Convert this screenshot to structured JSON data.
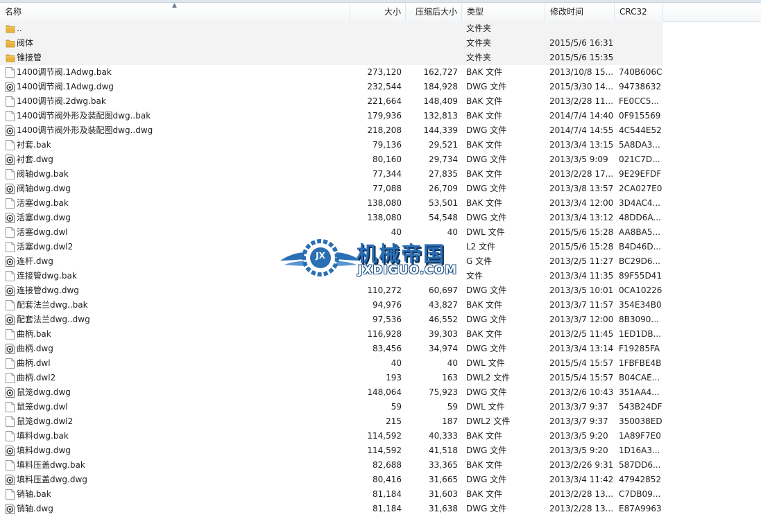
{
  "header": {
    "name": "名称",
    "size": "大小",
    "packed": "压缩后大小",
    "type": "类型",
    "modified": "修改时间",
    "crc": "CRC32"
  },
  "rows": [
    {
      "name": "..",
      "size": "",
      "packed": "",
      "type": "文件夹",
      "modified": "",
      "crc": "",
      "icon": "parent-folder"
    },
    {
      "name": "阀体",
      "size": "",
      "packed": "",
      "type": "文件夹",
      "modified": "2015/5/6 16:31",
      "crc": "",
      "icon": "folder"
    },
    {
      "name": "锥接管",
      "size": "",
      "packed": "",
      "type": "文件夹",
      "modified": "2015/5/6 15:35",
      "crc": "",
      "icon": "folder"
    },
    {
      "name": "1400调节阀.1Adwg.bak",
      "size": "273,120",
      "packed": "162,727",
      "type": "BAK 文件",
      "modified": "2013/10/8 15...",
      "crc": "740B606C",
      "icon": "file"
    },
    {
      "name": "1400调节阀.1Adwg.dwg",
      "size": "232,544",
      "packed": "184,928",
      "type": "DWG 文件",
      "modified": "2015/3/30 14...",
      "crc": "94738632",
      "icon": "dwg"
    },
    {
      "name": "1400调节阀.2dwg.bak",
      "size": "221,664",
      "packed": "148,409",
      "type": "BAK 文件",
      "modified": "2013/2/28 11...",
      "crc": "FE0CC5...",
      "icon": "file"
    },
    {
      "name": "1400调节阀外形及装配图dwg..bak",
      "size": "179,936",
      "packed": "132,813",
      "type": "BAK 文件",
      "modified": "2014/7/4 14:40",
      "crc": "0F915569",
      "icon": "file"
    },
    {
      "name": "1400调节阀外形及装配图dwg..dwg",
      "size": "218,208",
      "packed": "144,339",
      "type": "DWG 文件",
      "modified": "2014/7/4 14:55",
      "crc": "4C544E52",
      "icon": "dwg"
    },
    {
      "name": "衬套.bak",
      "size": "79,136",
      "packed": "29,521",
      "type": "BAK 文件",
      "modified": "2013/3/4 13:15",
      "crc": "5A8DA3...",
      "icon": "file"
    },
    {
      "name": "衬套.dwg",
      "size": "80,160",
      "packed": "29,734",
      "type": "DWG 文件",
      "modified": "2013/3/5 9:09",
      "crc": "021C7D...",
      "icon": "dwg"
    },
    {
      "name": "阀轴dwg.bak",
      "size": "77,344",
      "packed": "27,835",
      "type": "BAK 文件",
      "modified": "2013/2/28 17...",
      "crc": "9E29EFDF",
      "icon": "file"
    },
    {
      "name": "阀轴dwg.dwg",
      "size": "77,088",
      "packed": "26,709",
      "type": "DWG 文件",
      "modified": "2013/3/8 13:57",
      "crc": "2CA027E0",
      "icon": "dwg"
    },
    {
      "name": "活塞dwg.bak",
      "size": "138,080",
      "packed": "53,501",
      "type": "BAK 文件",
      "modified": "2013/3/4 12:00",
      "crc": "3D4AC4...",
      "icon": "file"
    },
    {
      "name": "活塞dwg.dwg",
      "size": "138,080",
      "packed": "54,548",
      "type": "DWG 文件",
      "modified": "2013/3/4 13:12",
      "crc": "48DD6A...",
      "icon": "dwg"
    },
    {
      "name": "活塞dwg.dwl",
      "size": "40",
      "packed": "40",
      "type": "DWL 文件",
      "modified": "2015/5/6 15:28",
      "crc": "AA8BA5...",
      "icon": "file"
    },
    {
      "name": "活塞dwg.dwl2",
      "size": "",
      "packed": "",
      "type": "L2 文件",
      "modified": "2015/5/6 15:28",
      "crc": "B4D46D...",
      "icon": "file"
    },
    {
      "name": "连杆.dwg",
      "size": "",
      "packed": "",
      "type": "G 文件",
      "modified": "2013/2/5 11:27",
      "crc": "BC29D6...",
      "icon": "dwg"
    },
    {
      "name": "连接管dwg.bak",
      "size": "",
      "packed": "",
      "type": "文件",
      "modified": "2013/3/4 11:35",
      "crc": "89F55D41",
      "icon": "file"
    },
    {
      "name": "连接管dwg.dwg",
      "size": "110,272",
      "packed": "60,697",
      "type": "DWG 文件",
      "modified": "2013/3/5 10:01",
      "crc": "0CA10226",
      "icon": "dwg"
    },
    {
      "name": "配套法兰dwg..bak",
      "size": "94,976",
      "packed": "43,827",
      "type": "BAK 文件",
      "modified": "2013/3/7 11:57",
      "crc": "354E34B0",
      "icon": "file"
    },
    {
      "name": "配套法兰dwg..dwg",
      "size": "97,536",
      "packed": "46,552",
      "type": "DWG 文件",
      "modified": "2013/3/7 12:00",
      "crc": "8B3090...",
      "icon": "dwg"
    },
    {
      "name": "曲柄.bak",
      "size": "116,928",
      "packed": "39,303",
      "type": "BAK 文件",
      "modified": "2013/2/5 11:45",
      "crc": "1ED1DB...",
      "icon": "file"
    },
    {
      "name": "曲柄.dwg",
      "size": "83,456",
      "packed": "34,974",
      "type": "DWG 文件",
      "modified": "2013/3/4 13:14",
      "crc": "F19285FA",
      "icon": "dwg"
    },
    {
      "name": "曲柄.dwl",
      "size": "40",
      "packed": "40",
      "type": "DWL 文件",
      "modified": "2015/5/4 15:57",
      "crc": "1FBFBE4B",
      "icon": "file"
    },
    {
      "name": "曲柄.dwl2",
      "size": "193",
      "packed": "163",
      "type": "DWL2 文件",
      "modified": "2015/5/4 15:57",
      "crc": "B04CAE...",
      "icon": "file"
    },
    {
      "name": "鼠笼dwg.dwg",
      "size": "148,064",
      "packed": "75,923",
      "type": "DWG 文件",
      "modified": "2013/2/6 10:43",
      "crc": "351AA4...",
      "icon": "dwg"
    },
    {
      "name": "鼠笼dwg.dwl",
      "size": "59",
      "packed": "59",
      "type": "DWL 文件",
      "modified": "2013/3/7 9:37",
      "crc": "543B24DF",
      "icon": "file"
    },
    {
      "name": "鼠笼dwg.dwl2",
      "size": "215",
      "packed": "187",
      "type": "DWL2 文件",
      "modified": "2013/3/7 9:37",
      "crc": "350038ED",
      "icon": "file"
    },
    {
      "name": "填料dwg.bak",
      "size": "114,592",
      "packed": "40,333",
      "type": "BAK 文件",
      "modified": "2013/3/5 9:20",
      "crc": "1A89F7E0",
      "icon": "file"
    },
    {
      "name": "填料dwg.dwg",
      "size": "114,592",
      "packed": "41,518",
      "type": "DWG 文件",
      "modified": "2013/3/5 9:20",
      "crc": "1D16A3...",
      "icon": "dwg"
    },
    {
      "name": "填料压盖dwg.bak",
      "size": "82,688",
      "packed": "33,365",
      "type": "BAK 文件",
      "modified": "2013/2/26 9:31",
      "crc": "587DD6...",
      "icon": "file"
    },
    {
      "name": "填料压盖dwg.dwg",
      "size": "80,416",
      "packed": "31,665",
      "type": "DWG 文件",
      "modified": "2013/3/4 11:42",
      "crc": "47942852",
      "icon": "dwg"
    },
    {
      "name": "销轴.bak",
      "size": "81,184",
      "packed": "31,603",
      "type": "BAK 文件",
      "modified": "2013/2/28 13...",
      "crc": "C7DB09...",
      "icon": "file"
    },
    {
      "name": "销轴.dwg",
      "size": "81,184",
      "packed": "31,638",
      "type": "DWG 文件",
      "modified": "2013/2/28 13...",
      "crc": "E87A9963",
      "icon": "dwg"
    }
  ],
  "watermark": {
    "title": "机械帝国",
    "url": "JXDIGUO.COM",
    "badge": "JX"
  },
  "colors": {
    "folder": "#e8b53a",
    "watermark_blue": "#2a6fb4",
    "row_alt": "#f3f3f3"
  }
}
